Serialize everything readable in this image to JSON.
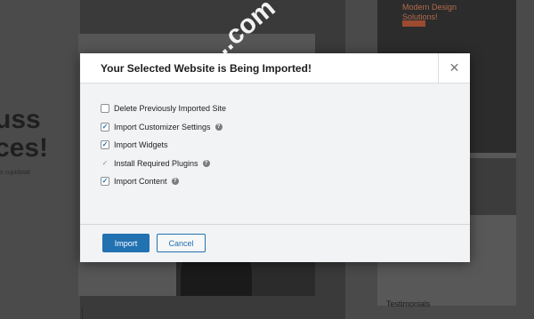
{
  "background": {
    "heading_lines": [
      "uss",
      "ces!"
    ],
    "small_text": "s cupidatat",
    "card_hero_text": [
      "Modern Design",
      "Solutions!"
    ],
    "testimonials_label": "Testimonials"
  },
  "modal": {
    "title": "Your Selected Website is Being Imported!",
    "close_icon": "close-icon",
    "options": [
      {
        "label": "Delete Previously Imported Site",
        "state": "unchecked",
        "has_help": false
      },
      {
        "label": "Import Customizer Settings",
        "state": "checked",
        "has_help": true
      },
      {
        "label": "Import Widgets",
        "state": "checked",
        "has_help": false
      },
      {
        "label": "Install Required Plugins",
        "state": "check-mark",
        "has_help": true
      },
      {
        "label": "Import Content",
        "state": "checked",
        "has_help": true
      }
    ],
    "buttons": {
      "import_label": "Import",
      "cancel_label": "Cancel"
    }
  },
  "watermark": "...com",
  "colors": {
    "accent": "#2271b1",
    "modal_bg": "#f1f3f5",
    "overlay": "#3a3a3a"
  }
}
